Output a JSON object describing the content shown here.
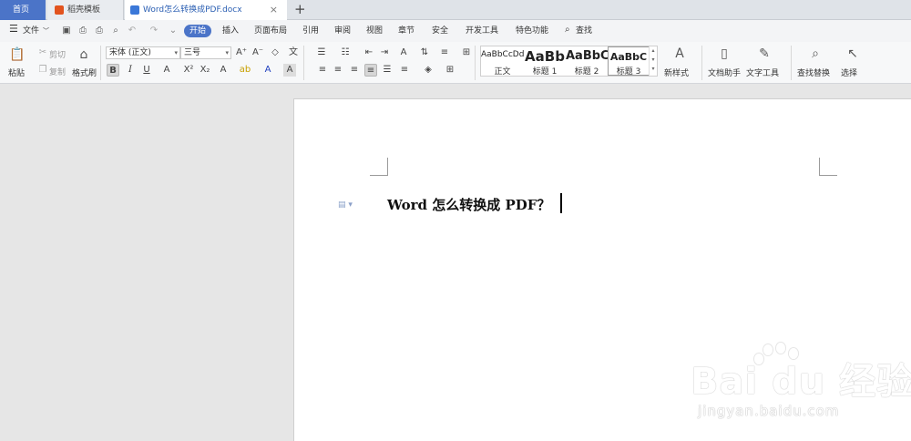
{
  "tabs": {
    "home": "首页",
    "template": "稻壳模板",
    "document": "Word怎么转换成PDF.docx",
    "close": "×",
    "add": "+"
  },
  "menu": {
    "file": "文件",
    "items": [
      "开始",
      "插入",
      "页面布局",
      "引用",
      "审阅",
      "视图",
      "章节",
      "安全",
      "开发工具",
      "特色功能"
    ],
    "search": "查找"
  },
  "ribbon": {
    "paste": "粘贴",
    "cut": "剪切",
    "copy": "复制",
    "format_painter": "格式刷",
    "font_name": "宋体 (正文)",
    "font_size": "三号",
    "styles": [
      {
        "sample": "AaBbCcDd",
        "name": "正文"
      },
      {
        "sample": "AaBb",
        "name": "标题 1"
      },
      {
        "sample": "AaBbC",
        "name": "标题 2"
      },
      {
        "sample": "AaBbC",
        "name": "标题 3"
      }
    ],
    "new_style": "新样式",
    "doc_assistant": "文档助手",
    "text_tools": "文字工具",
    "find_replace": "查找替换",
    "select": "选择"
  },
  "document": {
    "text": "Word 怎么转换成 PDF？"
  },
  "watermark": {
    "logo": "Bai du 经验",
    "url": "jingyan.baidu.com"
  }
}
